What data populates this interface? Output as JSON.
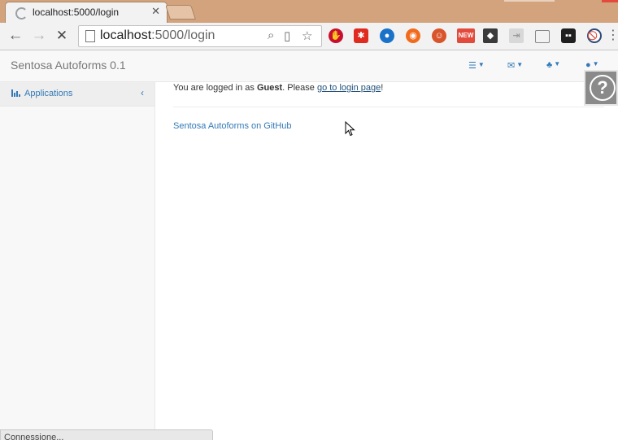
{
  "browser": {
    "tab_title": "localhost:5000/login",
    "url_host": "localhost",
    "url_path": ":5000/login"
  },
  "navbar": {
    "brand": "Sentosa Autoforms 0.1",
    "menus": [
      "tasks-icon",
      "envelope-icon",
      "bell-icon",
      "user-icon"
    ]
  },
  "sidebar": {
    "items": [
      {
        "label": "Applications",
        "icon": "bar-chart-icon"
      }
    ]
  },
  "main": {
    "login_message": {
      "prefix": "You are logged in as ",
      "user": "Guest",
      "middle": ". Please ",
      "link": "go to login page",
      "suffix": "!"
    },
    "github_link": "Sentosa Autoforms on GitHub"
  },
  "status": {
    "text": "Connessione..."
  },
  "colors": {
    "link": "#337ab7",
    "titlebar": "#d2a37c"
  }
}
